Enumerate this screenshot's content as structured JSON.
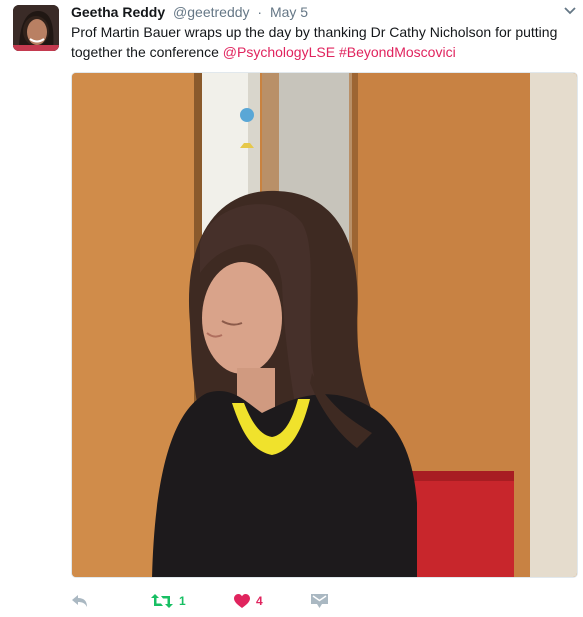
{
  "tweet": {
    "author_name": "Geetha Reddy",
    "author_handle": "@geetreddy",
    "separator": "·",
    "timestamp": "May 5",
    "text_plain": "Prof Martin Bauer wraps up the day by thanking Dr Cathy Nicholson for putting together the conference ",
    "hashtag_1": "@PsychologyLSE",
    "hashtag_2": "#BeyondMoscovici",
    "media_alt": "Woman with long brown hair wearing a black top and yellow necklace in front of wooden doors"
  },
  "actions": {
    "retweet_count": "1",
    "like_count": "4"
  },
  "colors": {
    "accent_pink": "#e0245e",
    "retweet_green": "#17bf63",
    "icon_grey": "#aab8c2",
    "muted_text": "#657786"
  },
  "icons": [
    "caret-down-icon",
    "reply-icon",
    "retweet-icon",
    "heart-icon",
    "direct-message-icon"
  ]
}
